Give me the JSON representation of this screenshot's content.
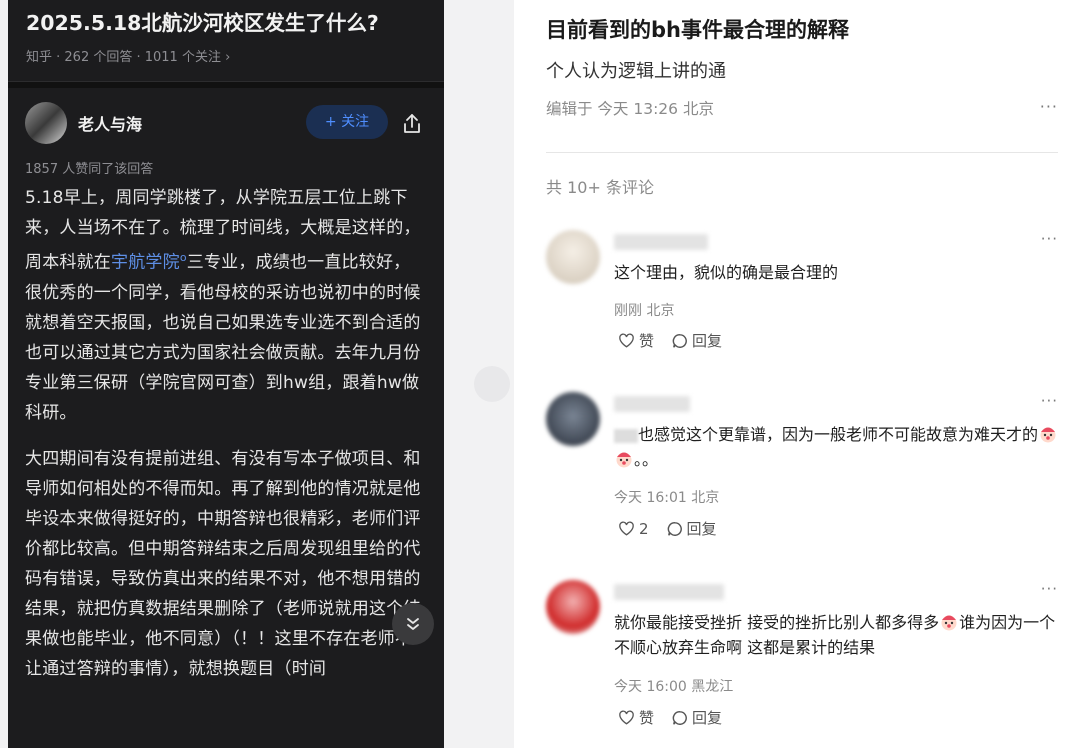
{
  "question": {
    "title": "2025.5.18北航沙河校区发生了什么?",
    "meta": "知乎 · 262 个回答 · 1011 个关注 ›"
  },
  "answer": {
    "author": "老人与海",
    "follow_label": "+ 关注",
    "votes": "1857 人赞同了该回答",
    "p1_before": "5.18早上，周同学跳楼了，从学院五层工位上跳下来，人当场不在了。梳理了时间线，大概是这样的，周本科就在",
    "p1_link": "宇航学院",
    "p1_after": "三专业，成绩也一直比较好，很优秀的一个同学，看他母校的采访也说初中的时候就想着空天报国，也说自己如果选专业选不到合适的也可以通过其它方式为国家社会做贡献。去年九月份专业第三保研（学院官网可查）到hw组，跟着hw做科研。",
    "p2": "大四期间有没有提前进组、有没有写本子做项目、和导师如何相处的不得而知。再了解到他的情况就是他毕设本来做得挺好的，中期答辩也很精彩，老师们评价都比较高。但中期答辩结束之后周发现组里给的代码有错误，导致仿真出来的结果不对，他不想用错的结果，就把仿真数据结果删除了（老师说就用这个结果做也能毕业，他不同意）（！！这里不存在老师不让通过答辩的事情），就想换题目（时间"
  },
  "article": {
    "title": "目前看到的bh事件最合理的解释",
    "subtitle": "个人认为逻辑上讲的通",
    "edited": "编辑于 今天 13:26 北京",
    "comment_count": "共 10+ 条评论"
  },
  "comments": [
    {
      "text": "这个理由，貌似的确是最合理的",
      "meta": "刚刚 北京",
      "like": "赞",
      "reply": "回复",
      "avatar_color": "#e4ddd2"
    },
    {
      "text": "也感觉这个更靠谱，因为一般老师不可能故意为难天才的",
      "text_end": "。。",
      "meta": "今天 16:01 北京",
      "like": "2",
      "reply": "回复",
      "avatar_color": "#3c4656"
    },
    {
      "text": "就你最能接受挫折 接受的挫折比别人都多得多",
      "text_end": "谁为因为一个不顺心放弃生命啊 这都是累计的结果",
      "meta": "今天 16:00 黑龙江",
      "like": "赞",
      "reply": "回复",
      "avatar_color": "#d23a3a"
    }
  ],
  "colors": {
    "dark_bg": "#1c1c1e",
    "link": "#5e8fe6",
    "follow_text": "#4f8eff"
  },
  "icons": [
    "share-icon",
    "chevron-down-icon",
    "heart-icon",
    "reply-icon",
    "more-icon"
  ]
}
